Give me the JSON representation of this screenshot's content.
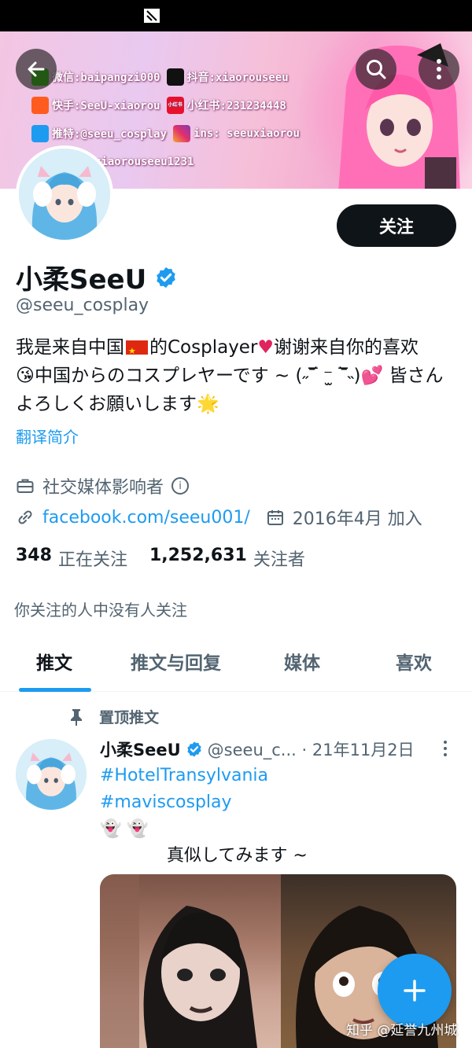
{
  "banner": {
    "row1": {
      "wechat": "微信:baipangzi000",
      "douyin": "抖音:xiaorouseeu"
    },
    "row2": {
      "kuaishou": "快手:SeeU-xiaorou",
      "xhs_icon": "小红书",
      "xhs": "小红书:231234448"
    },
    "row3": {
      "twitter": "推特:@seeu_cosplay",
      "instagram": "ins: seeuxiaorou"
    },
    "row4": {
      "weibo": "xiaorouseeu1231"
    }
  },
  "profile": {
    "follow_label": "关注",
    "name": "小柔SeeU",
    "handle": "@seeu_cosplay",
    "bio_1": "我是来自中国",
    "bio_2": "的Cosplayer",
    "bio_heart": "♥",
    "bio_3": "谢谢来自你的喜欢",
    "bio_4": "中国からのコスプレヤーです ~ (˶‾᷄ ⁻̫ ‾᷅˵)",
    "bio_5": "皆さんよろしくお願いします",
    "translate": "翻译简介",
    "category": "社交媒体影响者",
    "link": "facebook.com/seeu001/",
    "joined": "2016年4月 加入",
    "following_count": "348",
    "following_label": "正在关注",
    "followers_count": "1,252,631",
    "followers_label": "关注者",
    "mutual": "你关注的人中没有人关注"
  },
  "tabs": [
    "推文",
    "推文与回复",
    "媒体",
    "喜欢"
  ],
  "tweet": {
    "pinned_label": "置顶推文",
    "name": "小柔SeeU",
    "handle_date": "@seeu_c... · 21年11月2日",
    "hashtag1": "#HotelTransylvania",
    "hashtag2": "#maviscosplay",
    "ghosts": "👻 👻",
    "caption": "真似してみます ~"
  },
  "watermark": "知乎 @延誉九州城",
  "colors": {
    "accent": "#1d9bf0",
    "text": "#0f1419",
    "secondary": "#536471"
  }
}
